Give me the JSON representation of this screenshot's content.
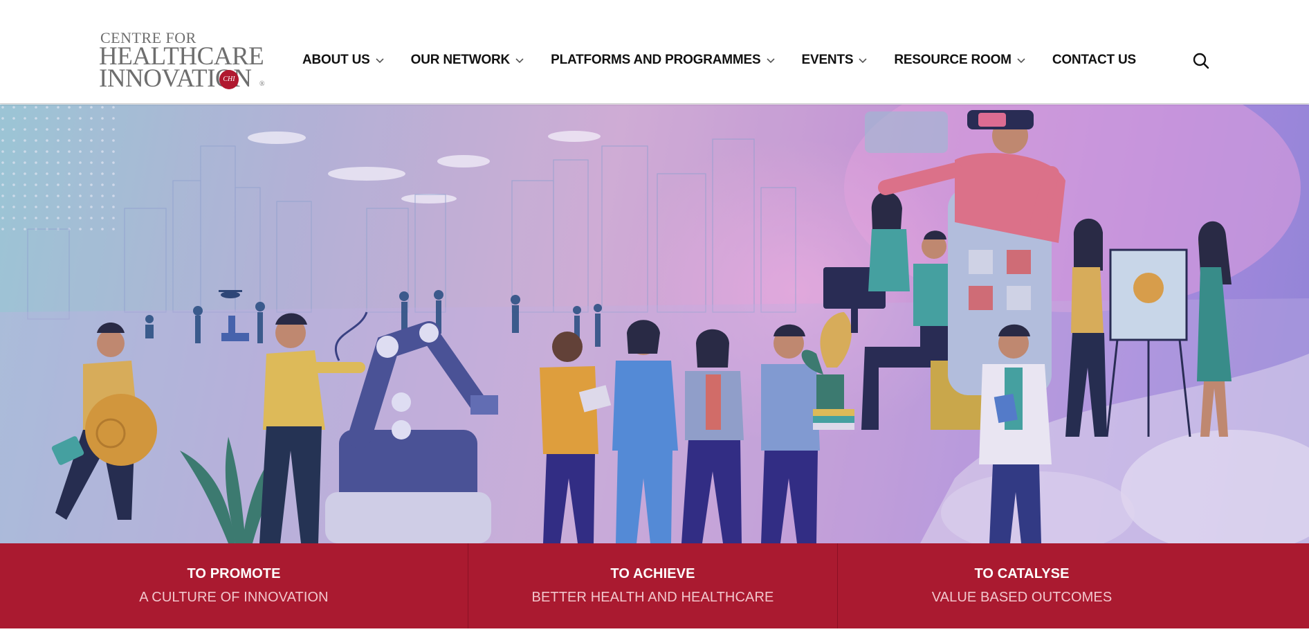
{
  "logo": {
    "line1": "CENTRE FOR",
    "line2": "HEALTHCARE",
    "line3": "INNOVATION",
    "badge": "CHI",
    "registered": "®"
  },
  "nav": {
    "items": [
      {
        "label": "ABOUT US",
        "has_dropdown": true
      },
      {
        "label": "OUR NETWORK",
        "has_dropdown": true
      },
      {
        "label": "PLATFORMS AND PROGRAMMES",
        "has_dropdown": true
      },
      {
        "label": "EVENTS",
        "has_dropdown": true
      },
      {
        "label": "RESOURCE ROOM",
        "has_dropdown": true
      },
      {
        "label": "CONTACT US",
        "has_dropdown": false
      }
    ],
    "search_icon": "search-icon"
  },
  "band": {
    "columns": [
      {
        "heading": "TO PROMOTE",
        "subheading": "A CULTURE OF INNOVATION"
      },
      {
        "heading": "TO ACHIEVE",
        "subheading": "BETTER HEALTH AND HEALTHCARE"
      },
      {
        "heading": "TO CATALYSE",
        "subheading": "VALUE BASED OUTCOMES"
      }
    ]
  },
  "colors": {
    "brand_red": "#aa1a30",
    "band_subtext": "#f2c6cc",
    "nav_text": "#111111",
    "logo_grey": "#6e6e6e"
  }
}
